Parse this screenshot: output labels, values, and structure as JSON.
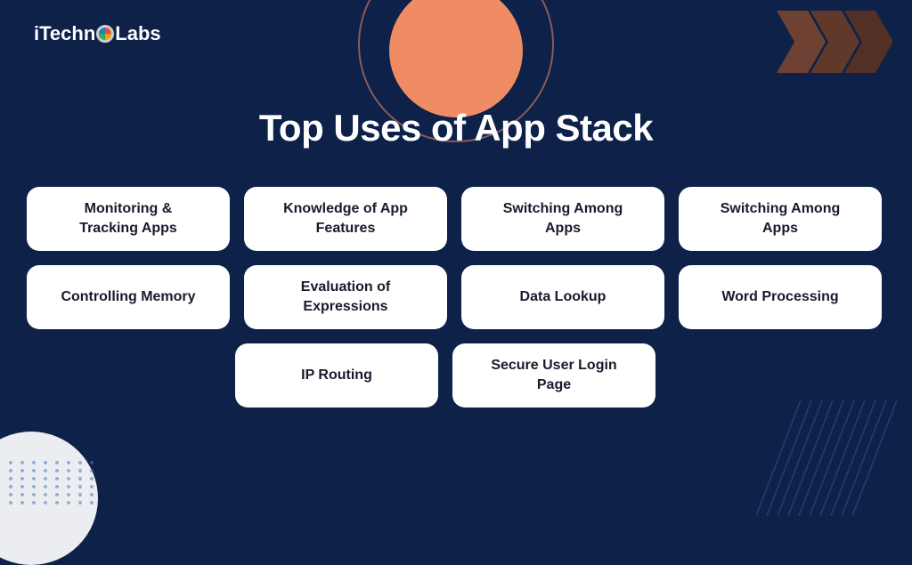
{
  "brand": {
    "name_part1": "iTechn",
    "name_part2": "Labs"
  },
  "title": "Top Uses of App Stack",
  "cards": {
    "row1": [
      {
        "id": "monitoring-tracking",
        "label": "Monitoring &\nTracking Apps"
      },
      {
        "id": "knowledge-app-features",
        "label": "Knowledge of App\nFeatures"
      },
      {
        "id": "switching-among-apps-1",
        "label": "Switching Among\nApps"
      },
      {
        "id": "switching-among-apps-2",
        "label": "Switching Among\nApps"
      }
    ],
    "row2": [
      {
        "id": "controlling-memory",
        "label": "Controlling Memory"
      },
      {
        "id": "evaluation-expressions",
        "label": "Evaluation of\nExpressions"
      },
      {
        "id": "data-lookup",
        "label": "Data Lookup"
      },
      {
        "id": "word-processing",
        "label": "Word Processing"
      }
    ],
    "row3": [
      {
        "id": "ip-routing",
        "label": "IP Routing"
      },
      {
        "id": "secure-user-login",
        "label": "Secure User Login\nPage"
      }
    ]
  }
}
